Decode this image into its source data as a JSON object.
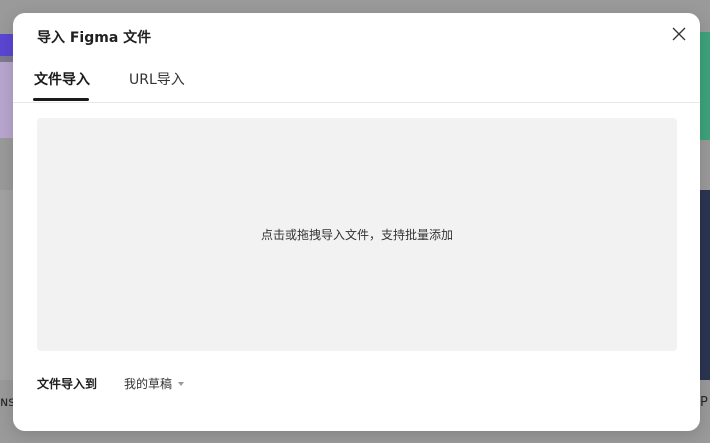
{
  "dialog": {
    "title": "导入 Figma 文件",
    "close_icon": "close-icon",
    "tabs": [
      {
        "label": "文件导入",
        "active": true
      },
      {
        "label": "URL导入",
        "active": false
      }
    ],
    "dropzone": {
      "text": "点击或拖拽导入文件，支持批量添加"
    },
    "destination": {
      "label": "文件导入到",
      "value": "我的草稿",
      "caret_icon": "caret-down-icon"
    }
  },
  "background": {
    "left_text": "ɴsc",
    "right_text": "P"
  },
  "colors": {
    "accent": "#1a1a1a",
    "dropzone_bg": "#f2f2f2"
  }
}
